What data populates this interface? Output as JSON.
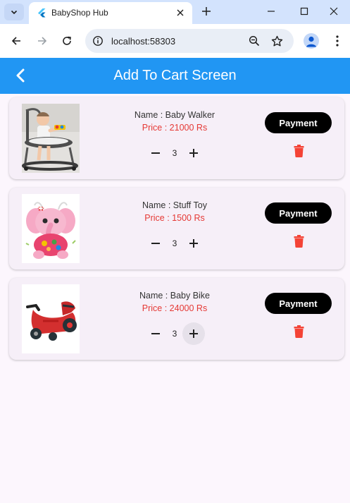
{
  "browser": {
    "tab_title": "BabyShop Hub",
    "url": "localhost:58303"
  },
  "appbar": {
    "title": "Add To Cart Screen"
  },
  "cart": {
    "items": [
      {
        "name": "Name : Baby Walker",
        "price": "Price : 21000 Rs",
        "quantity": "3",
        "payment_label": "Payment",
        "image_icon": "baby-walker-image"
      },
      {
        "name": "Name : Stuff Toy",
        "price": "Price : 1500 Rs",
        "quantity": "3",
        "payment_label": "Payment",
        "image_icon": "stuffed-elephant-image"
      },
      {
        "name": "Name : Baby Bike",
        "price": "Price : 24000 Rs",
        "quantity": "3",
        "payment_label": "Payment",
        "image_icon": "baby-bike-image"
      }
    ]
  },
  "colors": {
    "appbar": "#2196f3",
    "price": "#e53935",
    "delete": "#f44336",
    "payment_button": "#000000",
    "background": "#fcf6fd"
  }
}
